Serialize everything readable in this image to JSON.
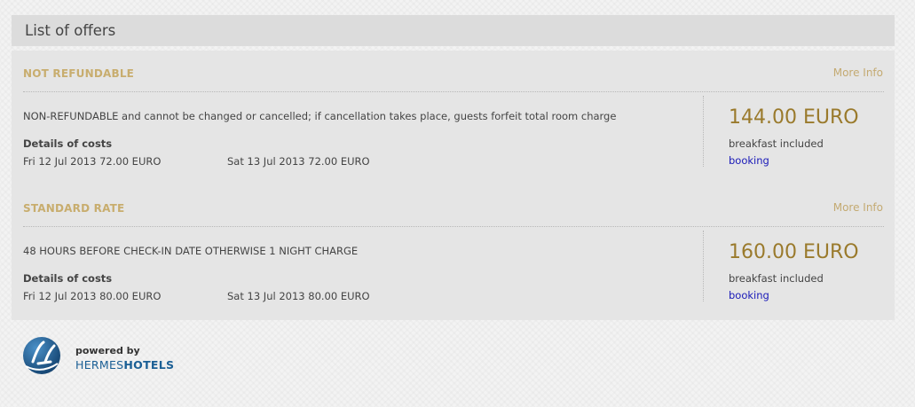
{
  "header": {
    "title": "List of offers"
  },
  "offers": [
    {
      "title": "NOT REFUNDABLE",
      "more_info": "More Info",
      "description": "NON-REFUNDABLE and cannot be changed or cancelled; if cancellation takes place, guests forfeit total room charge",
      "costs_label": "Details of costs",
      "costs": [
        "Fri 12 Jul 2013 72.00 EURO",
        "Sat 13 Jul 2013 72.00 EURO"
      ],
      "price": "144.00 EURO",
      "board": "breakfast included",
      "booking": "booking"
    },
    {
      "title": "STANDARD RATE",
      "more_info": "More Info",
      "description": "48 HOURS BEFORE CHECK-IN DATE OTHERWISE 1 NIGHT CHARGE",
      "costs_label": "Details of costs",
      "costs": [
        "Fri 12 Jul 2013 80.00 EURO",
        "Sat 13 Jul 2013 80.00 EURO"
      ],
      "price": "160.00 EURO",
      "board": "breakfast included",
      "booking": "booking"
    }
  ],
  "footer": {
    "powered_by": "powered by",
    "brand_part1": "HERMES",
    "brand_part2": "HOTELS",
    "logo_icon": "hermes-hotels-logo-icon"
  },
  "colors": {
    "accent_gold": "#c8ad6e",
    "price_gold": "#9a7a2c",
    "link_blue": "#1a1ab8",
    "brand_blue": "#1b5f95"
  }
}
